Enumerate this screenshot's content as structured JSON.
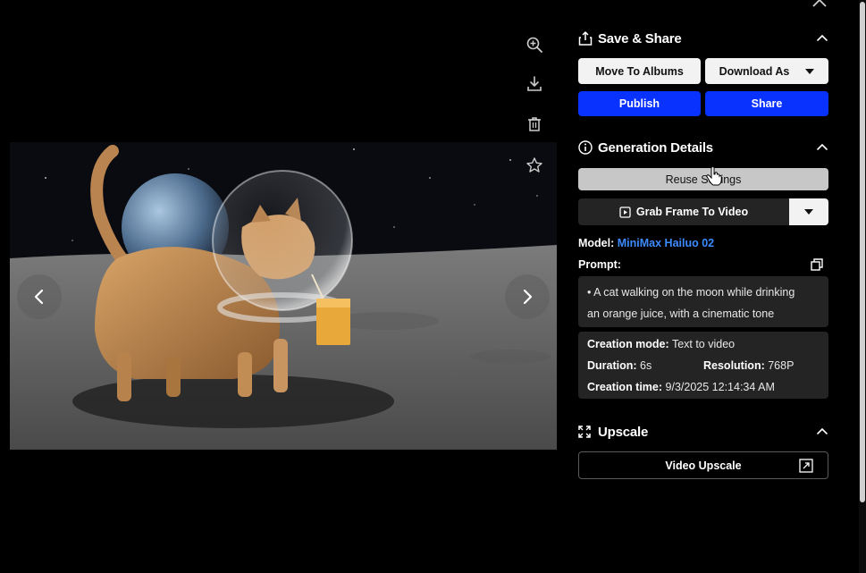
{
  "toolbar": {
    "zoom_icon": "zoom-in-icon",
    "download_icon": "download-icon",
    "delete_icon": "trash-icon",
    "favorite_icon": "star-icon"
  },
  "save_share": {
    "title": "Save & Share",
    "move_to_albums": "Move To Albums",
    "download_as": "Download As",
    "publish": "Publish",
    "share": "Share"
  },
  "generation": {
    "title": "Generation Details",
    "reuse_settings": "Reuse Settings",
    "grab_frame": "Grab Frame To Video",
    "model_label": "Model:",
    "model_value": "MiniMax Hailuo 02",
    "prompt_label": "Prompt:",
    "prompt_line1": "• A cat walking on the moon while drinking",
    "prompt_line2": "an orange juice, with a cinematic tone",
    "creation_mode_label": "Creation mode:",
    "creation_mode_value": "Text to video",
    "duration_label": "Duration:",
    "duration_value": "6s",
    "resolution_label": "Resolution:",
    "resolution_value": "768P",
    "creation_time_label": "Creation time:",
    "creation_time_value": "9/3/2025 12:14:34 AM"
  },
  "upscale": {
    "title": "Upscale",
    "video_upscale": "Video Upscale"
  },
  "colors": {
    "accent_blue": "#0a32ff",
    "link_blue": "#3d8bff",
    "panel_box": "#242424"
  }
}
